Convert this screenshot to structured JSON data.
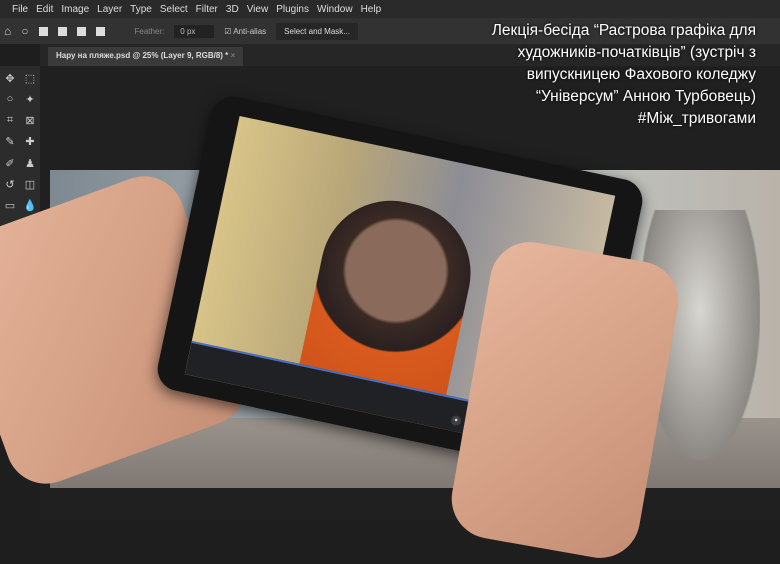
{
  "menu": [
    "File",
    "Edit",
    "Image",
    "Layer",
    "Type",
    "Select",
    "Filter",
    "3D",
    "View",
    "Plugins",
    "Window",
    "Help"
  ],
  "options": {
    "feather_label": "Feather:",
    "feather_value": "0 px",
    "antialias_label": "Anti-alias",
    "select_mask": "Select and Mask..."
  },
  "document_tab": "Нару на пляже.psd @ 25% (Layer 9, RGB/8) *",
  "title_lines": [
    "Лекція-бесіда “Растрова графіка для",
    "художників-початківців” (зустріч з",
    "випускницею Фахового коледжу",
    "“Універсум” Анною Турбовець)",
    "#Між_тривогами"
  ]
}
